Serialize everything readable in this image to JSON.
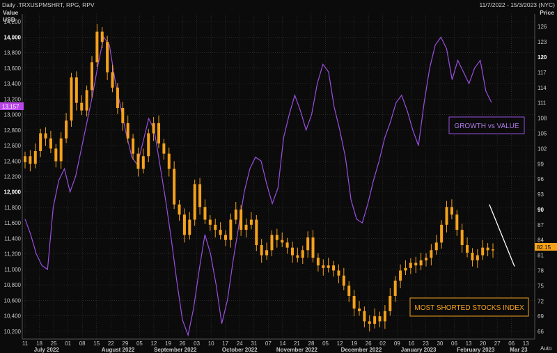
{
  "header": {
    "title": "Daily .TRXUSPMSHRT, RPG, RPV",
    "date_range": "11/7/2022 - 15/3/2023 (NYC)"
  },
  "axes": {
    "left_label_1": "Value",
    "left_label_2": "USD",
    "right_label": "Price",
    "auto_label": "Auto"
  },
  "annotations": {
    "growth": "GROWTH vs VALUE",
    "shorted": "MOST SHORTED STOCKS INDEX"
  },
  "colors": {
    "background": "#0b0b0b",
    "grid": "#3a3a3a",
    "candles": "#f5a21b",
    "growth_line": "#9a4fe0",
    "trendline": "#ffffff"
  },
  "chart_data": {
    "type": "line",
    "left_axis": {
      "label": "Value USD",
      "min": 10100,
      "max": 14300,
      "ticks": [
        10200,
        10400,
        10600,
        10800,
        11000,
        11200,
        11400,
        11600,
        11800,
        12000,
        12200,
        12400,
        12600,
        12800,
        13000,
        13200,
        13400,
        13600,
        13800,
        14000,
        14200
      ],
      "tick_labels": [
        "10,200",
        "10,400",
        "10,600",
        "10,800",
        "11,000",
        "11,200",
        "11,400",
        "11,600",
        "11,800",
        "12,000",
        "12,200",
        "12,400",
        "12,600",
        "12,800",
        "13,000",
        "13,200",
        "13,400",
        "13,600",
        "13,800",
        "14,000",
        "14,200"
      ],
      "bold_ticks": [
        "12,000",
        "14,000"
      ],
      "current_value_label": "13,157",
      "current_value": 13157
    },
    "right_axis": {
      "label": "Price",
      "min": 64.5,
      "max": 128.5,
      "ticks": [
        66,
        69,
        72,
        75,
        78,
        81,
        84,
        87,
        90,
        93,
        96,
        99,
        102,
        105,
        108,
        111,
        114,
        117,
        120,
        123,
        126
      ],
      "bold_ticks": [
        90,
        120
      ],
      "current_value_label": "82.15",
      "current_value": 82.15
    },
    "x_axis": {
      "day_labels": [
        "11",
        "18",
        "25",
        "01",
        "08",
        "15",
        "22",
        "29",
        "05",
        "12",
        "19",
        "26",
        "03",
        "10",
        "17",
        "24",
        "31",
        "07",
        "14",
        "21",
        "28",
        "05",
        "12",
        "19",
        "26",
        "02",
        "09",
        "16",
        "23",
        "30",
        "06",
        "13",
        "20",
        "27",
        "06",
        "13"
      ],
      "month_labels": [
        "July 2022",
        "August 2022",
        "September 2022",
        "October 2022",
        "November 2022",
        "December 2022",
        "January 2023",
        "February 2023",
        "Mar 23"
      ],
      "month_label_anchors": [
        1.5,
        6.5,
        10.5,
        15.0,
        19.0,
        23.5,
        27.5,
        31.5,
        34.5
      ]
    },
    "series": [
      {
        "name": "MOST SHORTED STOCKS INDEX",
        "axis": "right",
        "kind": "candlestick",
        "close": [
          100.5,
          99.0,
          101.5,
          105.0,
          104.0,
          102.0,
          99.5,
          104.0,
          107.5,
          116.0,
          111.0,
          109.5,
          113.5,
          119.0,
          125.0,
          123.0,
          117.0,
          114.0,
          110.0,
          107.0,
          104.0,
          101.0,
          98.0,
          100.5,
          105.0,
          107.0,
          103.0,
          101.0,
          98.0,
          91.0,
          89.0,
          85.0,
          88.0,
          95.0,
          90.5,
          88.0,
          87.0,
          86.0,
          85.0,
          84.0,
          88.0,
          90.0,
          86.0,
          87.0,
          88.0,
          83.0,
          81.0,
          82.0,
          85.0,
          84.0,
          83.5,
          82.5,
          81.0,
          80.5,
          82.0,
          84.5,
          80.5,
          79.0,
          78.5,
          79.0,
          78.0,
          77.0,
          75.0,
          73.0,
          70.5,
          70.0,
          68.0,
          67.5,
          69.0,
          68.0,
          70.0,
          73.0,
          76.0,
          78.0,
          78.5,
          79.5,
          79.0,
          80.0,
          80.5,
          82.0,
          83.5,
          87.0,
          90.5,
          89.0,
          86.0,
          83.0,
          81.5,
          80.0,
          81.0,
          82.5,
          82.0,
          82.15
        ]
      },
      {
        "name": "GROWTH vs VALUE",
        "axis": "left",
        "kind": "line",
        "values": [
          11650,
          11450,
          11200,
          11050,
          11000,
          11800,
          12150,
          12300,
          12000,
          12200,
          12550,
          12900,
          13250,
          13650,
          14000,
          13900,
          13450,
          13100,
          12750,
          12450,
          12350,
          12650,
          12950,
          12800,
          12350,
          11900,
          11400,
          10850,
          10350,
          10150,
          10500,
          11000,
          11450,
          11200,
          10800,
          10300,
          10600,
          11100,
          11550,
          12000,
          12300,
          12450,
          12400,
          12100,
          11850,
          12050,
          12700,
          13000,
          13250,
          13050,
          12800,
          13000,
          13400,
          13650,
          13550,
          13100,
          12800,
          12450,
          11900,
          11650,
          11600,
          11850,
          12150,
          12400,
          12700,
          12900,
          13150,
          13250,
          13050,
          12800,
          12600,
          13150,
          13600,
          13900,
          14000,
          13850,
          13450,
          13700,
          13550,
          13400,
          13600,
          13700,
          13300,
          13157
        ]
      },
      {
        "name": "",
        "axis": "right",
        "kind": "trendline",
        "points": [
          [
            90.3,
            91.0
          ],
          [
            95.2,
            78.8
          ]
        ]
      }
    ]
  }
}
